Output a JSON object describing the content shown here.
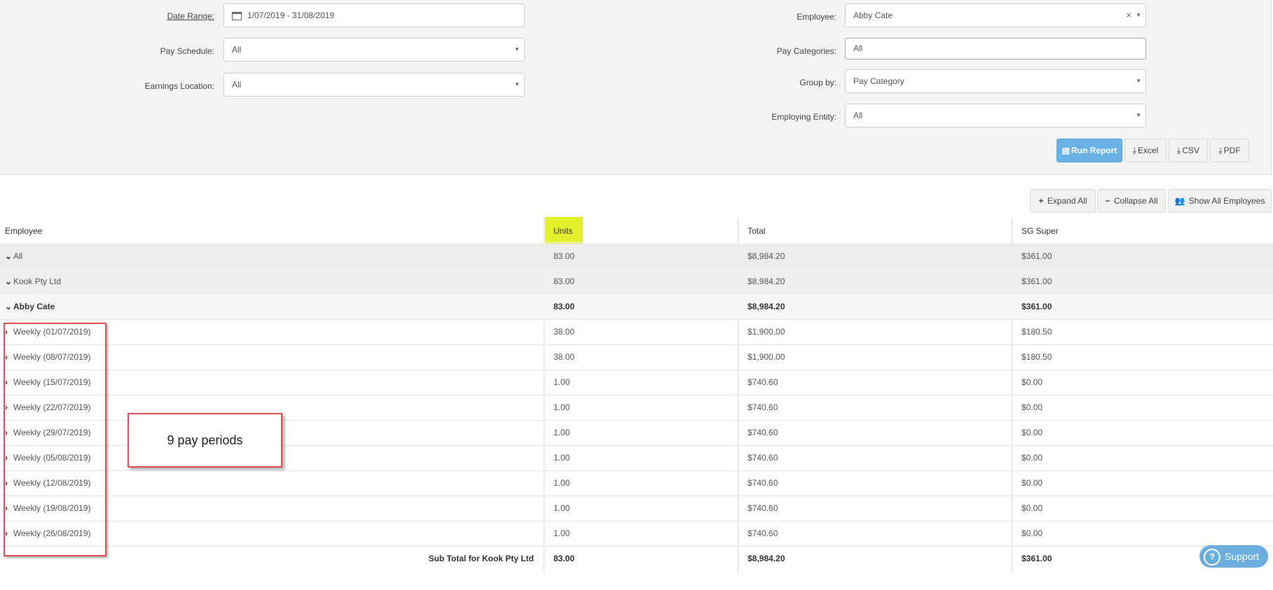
{
  "filters": {
    "date_range_label": "Date Range:",
    "date_range_value": "1/07/2019 - 31/08/2019",
    "pay_schedule_label": "Pay Schedule:",
    "pay_schedule_value": "All",
    "earnings_location_label": "Earnings Location:",
    "earnings_location_value": "All",
    "employee_label": "Employee:",
    "employee_value": "Abby Cate",
    "pay_categories_label": "Pay Categories:",
    "pay_categories_value": "All",
    "group_by_label": "Group by:",
    "group_by_value": "Pay Category",
    "employing_entity_label": "Employing Entity:",
    "employing_entity_value": "All"
  },
  "actions": {
    "run_report": "Run Report",
    "excel": "Excel",
    "csv": "CSV",
    "pdf": "PDF"
  },
  "table_actions": {
    "expand_all": "Expand All",
    "collapse_all": "Collapse All",
    "show_all_employees": "Show All Employees"
  },
  "table": {
    "headers": [
      "Employee",
      "Units",
      "Total",
      "SG Super"
    ],
    "rows": [
      {
        "name": "All",
        "units": "83.00",
        "total": "$8,984.20",
        "super": "$361.00"
      },
      {
        "name": "Kook Pty Ltd",
        "units": "83.00",
        "total": "$8,984.20",
        "super": "$361.00"
      },
      {
        "name": "Abby Cate",
        "units": "83.00",
        "total": "$8,984.20",
        "super": "$361.00"
      },
      {
        "name": "Weekly (01/07/2019)",
        "units": "38.00",
        "total": "$1,900.00",
        "super": "$180.50"
      },
      {
        "name": "Weekly (08/07/2019)",
        "units": "38.00",
        "total": "$1,900.00",
        "super": "$180.50"
      },
      {
        "name": "Weekly (15/07/2019)",
        "units": "1.00",
        "total": "$740.60",
        "super": "$0.00"
      },
      {
        "name": "Weekly (22/07/2019)",
        "units": "1.00",
        "total": "$740.60",
        "super": "$0.00"
      },
      {
        "name": "Weekly (29/07/2019)",
        "units": "1.00",
        "total": "$740.60",
        "super": "$0.00"
      },
      {
        "name": "Weekly (05/08/2019)",
        "units": "1.00",
        "total": "$740.60",
        "super": "$0.00"
      },
      {
        "name": "Weekly (12/08/2019)",
        "units": "1.00",
        "total": "$740.60",
        "super": "$0.00"
      },
      {
        "name": "Weekly (19/08/2019)",
        "units": "1.00",
        "total": "$740.60",
        "super": "$0.00"
      },
      {
        "name": "Weekly (26/08/2019)",
        "units": "1.00",
        "total": "$740.60",
        "super": "$0.00"
      }
    ],
    "subtotal": {
      "label": "Sub Total for Kook Pty Ltd",
      "units": "83.00",
      "total": "$8,984.20",
      "super": "$361.00"
    }
  },
  "annotation": {
    "callout_text": "9 pay periods",
    "color": "#e35050"
  },
  "highlight_color": "#e3f02c",
  "accent": "#6ab2e6",
  "support_label": "Support"
}
